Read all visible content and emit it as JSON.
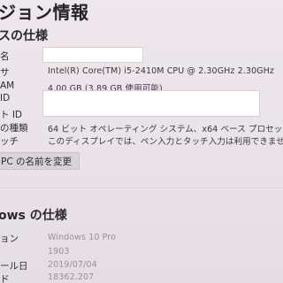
{
  "page": {
    "title": "ジョン情報"
  },
  "device_spec": {
    "heading": "スの仕様",
    "rows": [
      {
        "label": "名",
        "value": ""
      },
      {
        "label": "サ",
        "value": "Intel(R) Core(TM) i5-2410M CPU @ 2.30GHz   2.30GHz"
      },
      {
        "label": "AM",
        "value": "4.00 GB (3.89 GB 使用可能)"
      },
      {
        "label": "ID",
        "value": ""
      },
      {
        "label": "ト ID",
        "value": ""
      },
      {
        "label": "の種類",
        "value": "64 ビット オペレーティング システム、x64 ベース プロセッサ"
      },
      {
        "label": "ッチ",
        "value": "このディスプレイでは、ペン入力とタッチ入力は利用できません"
      }
    ],
    "rename_button": "PC の名前を変更"
  },
  "windows_spec": {
    "heading": "ows の仕様",
    "rows": [
      {
        "label": "ョン",
        "value": "Windows 10 Pro"
      },
      {
        "label": "",
        "value": "1903"
      },
      {
        "label": "ール日",
        "value": "2019/07/04"
      },
      {
        "label": "ド",
        "value": "18362.207"
      }
    ]
  }
}
